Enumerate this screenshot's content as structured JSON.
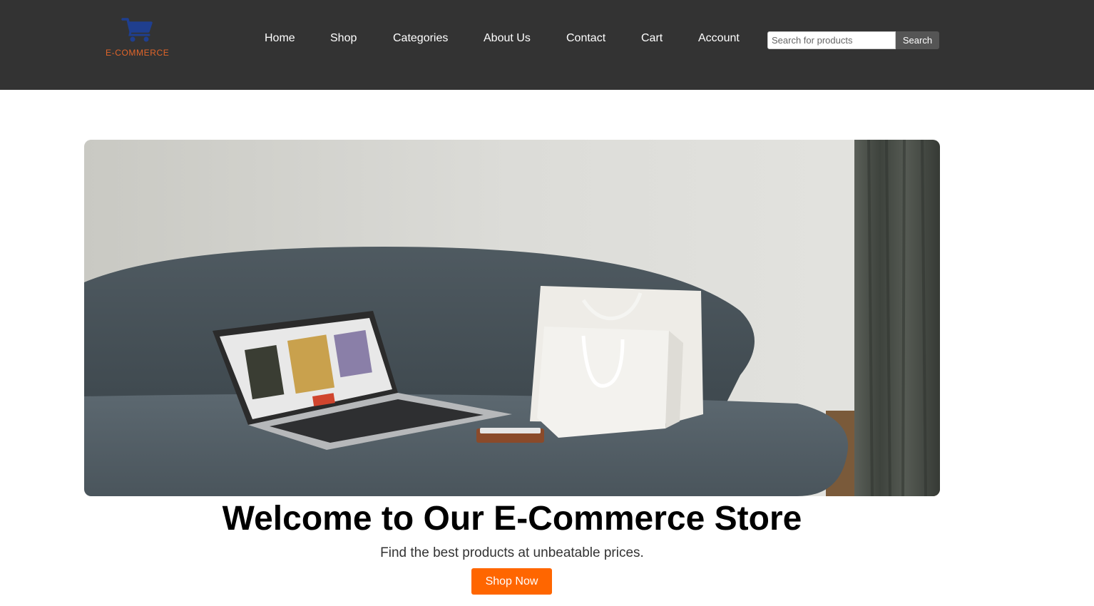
{
  "brand": {
    "logo_text": "E-COMMERCE",
    "icon": "shopping-cart-icon",
    "logo_color": "#e0652a",
    "cart_color": "#1f3f8f"
  },
  "nav": {
    "items": [
      "Home",
      "Shop",
      "Categories",
      "About Us",
      "Contact",
      "Cart",
      "Account"
    ]
  },
  "search": {
    "placeholder": "Search for products",
    "value": "",
    "button_label": "Search"
  },
  "hero": {
    "image_alt": "laptop and shopping bags on a sofa",
    "title": "Welcome to Our E-Commerce Store",
    "subtitle": "Find the best products at unbeatable prices.",
    "cta_label": "Shop Now",
    "accent": "#ff6600"
  },
  "colors": {
    "header_bg": "#333333",
    "page_bg": "#ffffff"
  }
}
